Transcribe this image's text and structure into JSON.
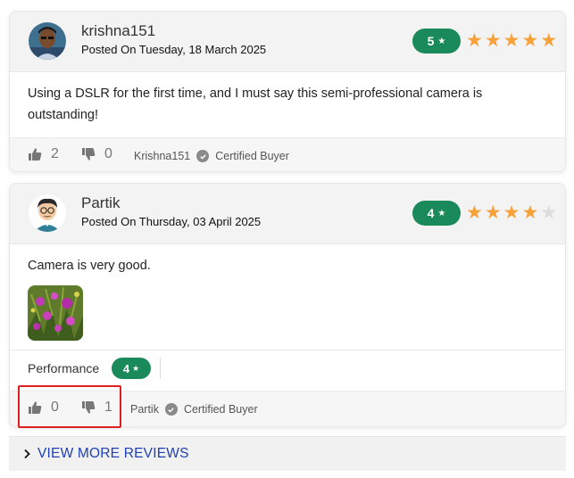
{
  "reviews": [
    {
      "username": "krishna151",
      "posted": "Posted On Tuesday, 18 March 2025",
      "rating": "5",
      "stars_filled": 5,
      "stars_total": 5,
      "text": "Using a DSLR for the first time, and I must say this semi-professional camera is outstanding!",
      "likes": "2",
      "dislikes": "0",
      "buyer_name": "Krishna151",
      "buyer_badge": "Certified Buyer"
    },
    {
      "username": "Partik",
      "posted": "Posted On Thursday, 03 April 2025",
      "rating": "4",
      "stars_filled": 4,
      "stars_total": 5,
      "text": "Camera is very good.",
      "aspect_label": "Performance",
      "aspect_rating": "4",
      "likes": "0",
      "dislikes": "1",
      "buyer_name": "Partik",
      "buyer_badge": "Certified Buyer"
    }
  ],
  "view_more": "VIEW MORE REVIEWS",
  "colors": {
    "rating_green": "#1a8a5a",
    "star_orange": "#f6a13a",
    "link_blue": "#1f3fb3",
    "highlight_red": "#e02020"
  },
  "icons": {
    "like": "thumbs-up-icon",
    "dislike": "thumbs-down-icon",
    "verified": "check-circle-icon",
    "expand": "chevron-right-icon"
  }
}
